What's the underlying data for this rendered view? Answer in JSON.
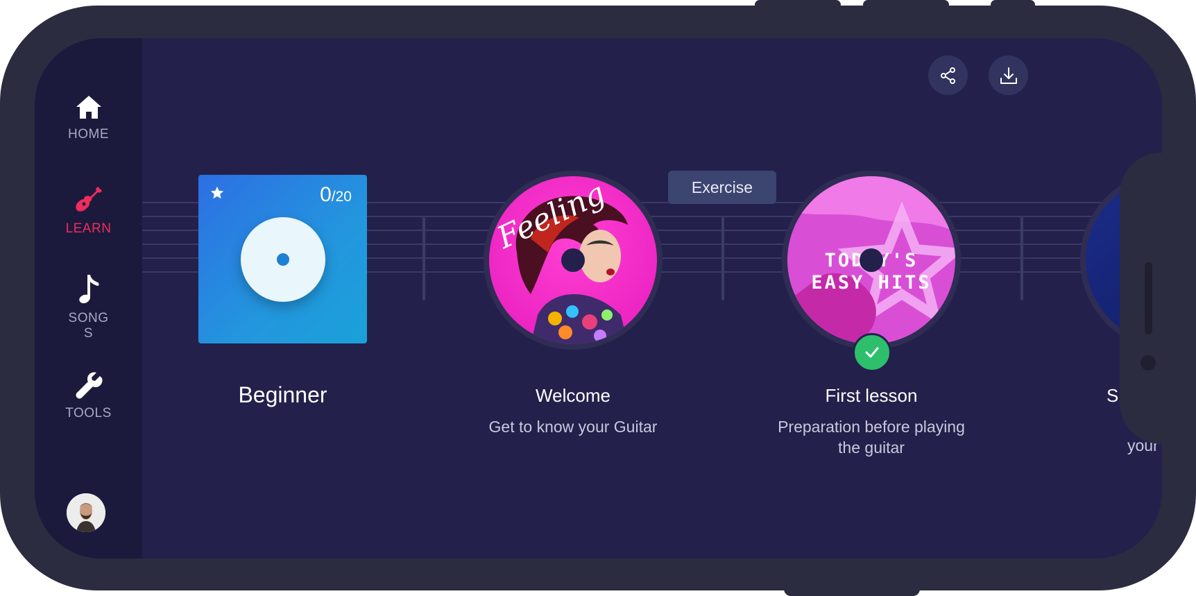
{
  "sidebar": {
    "items": [
      {
        "label": "HOME",
        "icon": "home-icon",
        "active": false
      },
      {
        "label": "LEARN",
        "icon": "guitar-icon",
        "active": true
      },
      {
        "label": "SONGS",
        "icon": "music-note-icon",
        "active": false
      },
      {
        "label": "TOOLS",
        "icon": "wrench-icon",
        "active": false
      }
    ],
    "avatar": "user-avatar"
  },
  "header": {
    "share_icon": "share-icon",
    "download_icon": "download-icon"
  },
  "beginner_card": {
    "icon": "star-icon",
    "progress_current": "0",
    "progress_total": "/20",
    "title": "Beginner"
  },
  "tooltip": {
    "label": "Exercise"
  },
  "lessons": [
    {
      "title": "Welcome",
      "subtitle": "Get to know your Guitar",
      "cover_text": "Feeling",
      "completed": false
    },
    {
      "title": "First lesson",
      "subtitle": "Preparation before playing the guitar",
      "cover_text": "TODAY'S EASY HITS",
      "completed": true
    },
    {
      "title": "S",
      "subtitle": "your",
      "completed": false
    }
  ],
  "colors": {
    "background": "#23214b",
    "sidebar": "#1b1a3c",
    "accent": "#ee2c5d",
    "success": "#2dbf6b",
    "card": "#2396de"
  }
}
